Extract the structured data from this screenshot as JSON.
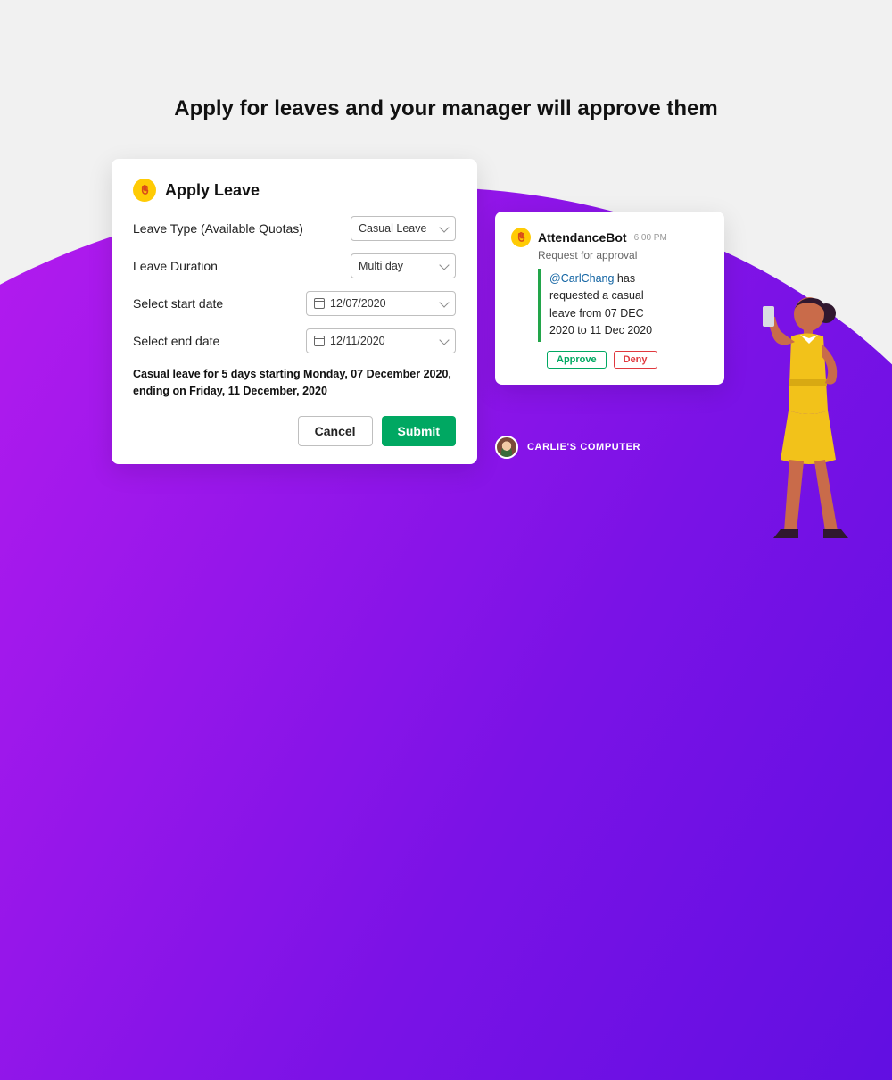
{
  "heading": "Apply for leaves and your manager will approve them",
  "apply_card": {
    "title": "Apply Leave",
    "fields": {
      "leave_type_label": "Leave Type (Available Quotas)",
      "leave_type_value": "Casual Leave",
      "duration_label": "Leave Duration",
      "duration_value": "Multi day",
      "start_label": "Select start date",
      "start_value": "12/07/2020",
      "end_label": "Select end date",
      "end_value": "12/11/2020"
    },
    "summary": "Casual leave for 5 days starting Monday, 07 December 2020, ending on Friday, 11 December, 2020",
    "cancel": "Cancel",
    "submit": "Submit"
  },
  "bot_card": {
    "name": "AttendanceBot",
    "time": "6:00 PM",
    "subtitle": "Request for approval",
    "mention": "@CarlChang",
    "message_rest": " has requested a casual leave from 07 DEC 2020 to 11 Dec 2020",
    "approve": "Approve",
    "deny": "Deny"
  },
  "user": {
    "name": "CARLIE'S COMPUTER"
  }
}
